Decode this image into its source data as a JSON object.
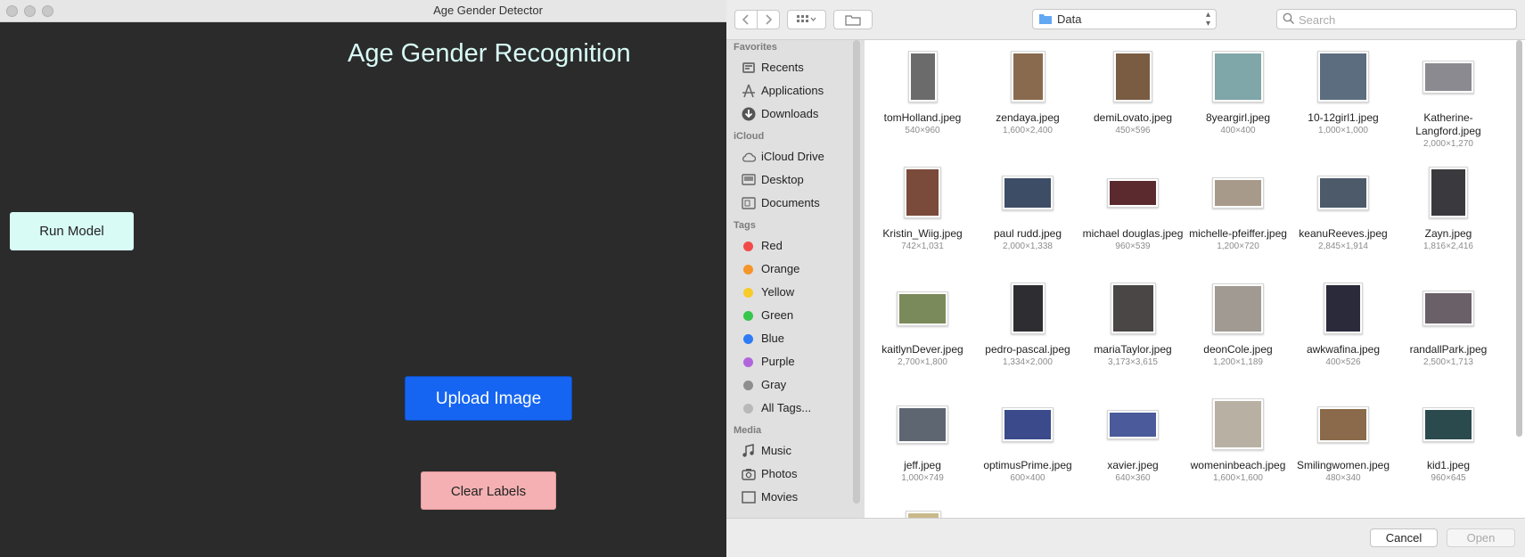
{
  "app": {
    "title": "Age Gender Detector",
    "heading": "Age Gender Recognition",
    "run_model_label": "Run Model",
    "upload_label": "Upload Image",
    "clear_label": "Clear Labels"
  },
  "dialog": {
    "location": "Data",
    "search_placeholder": "Search",
    "cancel_label": "Cancel",
    "open_label": "Open",
    "sidebar": {
      "favorites_header": "Favorites",
      "favorites": [
        {
          "label": "Recents",
          "icon": "clock-icon"
        },
        {
          "label": "Applications",
          "icon": "applications-icon"
        },
        {
          "label": "Downloads",
          "icon": "download-icon"
        }
      ],
      "icloud_header": "iCloud",
      "icloud": [
        {
          "label": "iCloud Drive",
          "icon": "cloud-icon"
        },
        {
          "label": "Desktop",
          "icon": "desktop-icon"
        },
        {
          "label": "Documents",
          "icon": "document-icon"
        }
      ],
      "tags_header": "Tags",
      "tags": [
        {
          "label": "Red",
          "color": "#f24a4a"
        },
        {
          "label": "Orange",
          "color": "#f5952a"
        },
        {
          "label": "Yellow",
          "color": "#f7cb2a"
        },
        {
          "label": "Green",
          "color": "#37c64c"
        },
        {
          "label": "Blue",
          "color": "#2e7bf3"
        },
        {
          "label": "Purple",
          "color": "#b165dc"
        },
        {
          "label": "Gray",
          "color": "#8e8e8e"
        },
        {
          "label": "All Tags...",
          "color": "#b9b9b9"
        }
      ],
      "media_header": "Media",
      "media": [
        {
          "label": "Music",
          "icon": "music-icon"
        },
        {
          "label": "Photos",
          "icon": "camera-icon"
        },
        {
          "label": "Movies",
          "icon": "film-icon"
        }
      ]
    },
    "files": [
      {
        "name": "tomHolland.jpeg",
        "dims": "540×960",
        "color": "#6b6b6b"
      },
      {
        "name": "zendaya.jpeg",
        "dims": "1,600×2,400",
        "color": "#8a6a4e"
      },
      {
        "name": "demiLovato.jpeg",
        "dims": "450×596",
        "color": "#7a5c43"
      },
      {
        "name": "8yeargirl.jpeg",
        "dims": "400×400",
        "color": "#7fa6a8"
      },
      {
        "name": "10-12girl1.jpeg",
        "dims": "1,000×1,000",
        "color": "#5b6d7e"
      },
      {
        "name": "Katherine-Langford.jpeg",
        "dims": "2,000×1,270",
        "color": "#8a8a90"
      },
      {
        "name": "Kristin_Wiig.jpeg",
        "dims": "742×1,031",
        "color": "#7a4a3a"
      },
      {
        "name": "paul rudd.jpeg",
        "dims": "2,000×1,338",
        "color": "#3e4d66"
      },
      {
        "name": "michael douglas.jpeg",
        "dims": "960×539",
        "color": "#5a2a2e"
      },
      {
        "name": "michelle-pfeiffer.jpeg",
        "dims": "1,200×720",
        "color": "#a89a8a"
      },
      {
        "name": "keanuReeves.jpeg",
        "dims": "2,845×1,914",
        "color": "#4c5a6a"
      },
      {
        "name": "Zayn.jpeg",
        "dims": "1,816×2,416",
        "color": "#3a3a3e"
      },
      {
        "name": "kaitlynDever.jpeg",
        "dims": "2,700×1,800",
        "color": "#7a8a5a"
      },
      {
        "name": "pedro-pascal.jpeg",
        "dims": "1,334×2,000",
        "color": "#2e2e32"
      },
      {
        "name": "mariaTaylor.jpeg",
        "dims": "3,173×3,615",
        "color": "#4a4646"
      },
      {
        "name": "deonCole.jpeg",
        "dims": "1,200×1,189",
        "color": "#a09a92"
      },
      {
        "name": "awkwafina.jpeg",
        "dims": "400×526",
        "color": "#2a2a3a"
      },
      {
        "name": "randallPark.jpeg",
        "dims": "2,500×1,713",
        "color": "#6a6068"
      },
      {
        "name": "jeff.jpeg",
        "dims": "1,000×749",
        "color": "#5e6672"
      },
      {
        "name": "optimusPrime.jpeg",
        "dims": "600×400",
        "color": "#3a4a8a"
      },
      {
        "name": "xavier.jpeg",
        "dims": "640×360",
        "color": "#4a5a9a"
      },
      {
        "name": "womeninbeach.jpeg",
        "dims": "1,600×1,600",
        "color": "#b8b0a2"
      },
      {
        "name": "Smilingwomen.jpeg",
        "dims": "480×340",
        "color": "#8a6a4a"
      },
      {
        "name": "kid1.jpeg",
        "dims": "960×645",
        "color": "#2a4a4e"
      }
    ]
  }
}
